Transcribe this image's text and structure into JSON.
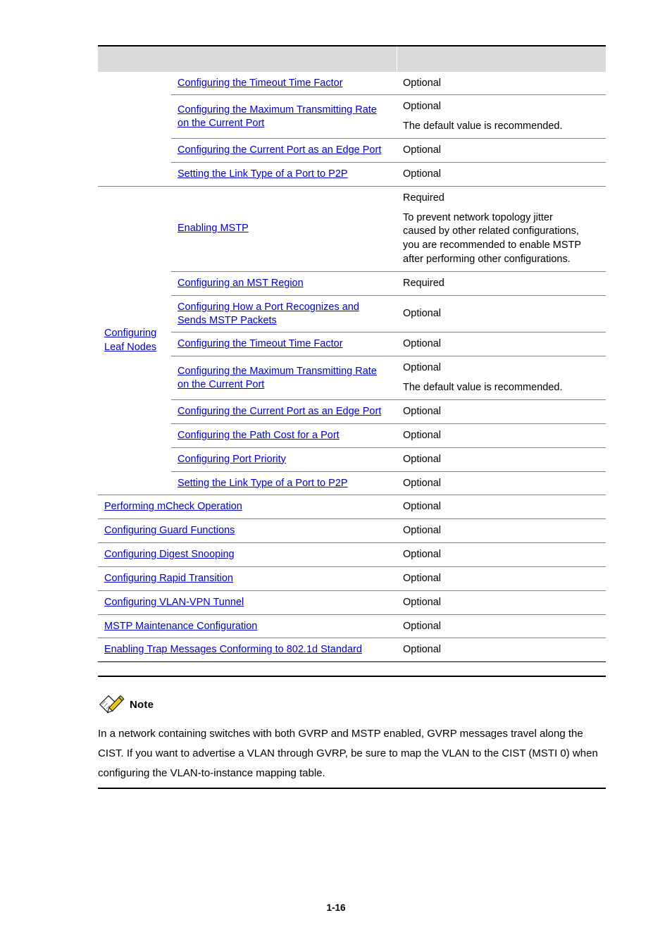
{
  "page": {
    "number": "1-16"
  },
  "table": {
    "header": {
      "col1": "",
      "col2": "",
      "col3": ""
    },
    "groups": [
      {
        "name": "",
        "rows": [
          {
            "task": "Configuring the Timeout Time Factor",
            "value": "Optional",
            "value2": ""
          },
          {
            "task": "Configuring the Maximum Transmitting Rate on the Current Port",
            "value": "Optional",
            "value2": "The default value is recommended."
          },
          {
            "task": "Configuring the Current Port as an Edge Port",
            "value": "Optional",
            "value2": ""
          },
          {
            "task": "Setting the Link Type of a Port to P2P",
            "value": "Optional",
            "value2": ""
          }
        ]
      },
      {
        "name": "Configuring Leaf Nodes",
        "name_line1": "Configuring",
        "name_line2": "Leaf Nodes",
        "rows": [
          {
            "task": "Enabling MSTP",
            "value": "Required",
            "value2_lines": [
              "To prevent network topology jitter",
              "caused by other related configurations,",
              "you are recommended to enable MSTP",
              "after performing other configurations."
            ]
          },
          {
            "task": "Configuring an MST Region",
            "value": "Required",
            "value2": ""
          },
          {
            "task": "Configuring How a Port Recognizes and Sends MSTP Packets",
            "value": "Optional",
            "value2": ""
          },
          {
            "task": "Configuring the Timeout Time Factor",
            "value": "Optional",
            "value2": ""
          },
          {
            "task": "Configuring the Maximum Transmitting Rate on the Current Port",
            "value": "Optional",
            "value2": "The default value is recommended."
          },
          {
            "task": "Configuring the Current Port as an Edge Port",
            "value": "Optional",
            "value2": ""
          },
          {
            "task": "Configuring the Path Cost for a Port",
            "value": "Optional",
            "value2": ""
          },
          {
            "task": "Configuring Port Priority",
            "value": "Optional",
            "value2": ""
          },
          {
            "task": "Setting the Link Type of a Port to P2P",
            "value": "Optional",
            "value2": ""
          }
        ]
      }
    ],
    "full_rows": [
      {
        "task": "Performing mCheck Operation",
        "value": "Optional"
      },
      {
        "task": "Configuring Guard Functions",
        "value": "Optional"
      },
      {
        "task": "Configuring Digest Snooping",
        "value": "Optional"
      },
      {
        "task": "Configuring Rapid Transition",
        "value": "Optional"
      },
      {
        "task": "Configuring VLAN-VPN Tunnel",
        "value": "Optional"
      },
      {
        "task": "MSTP Maintenance Configuration",
        "value": "Optional"
      },
      {
        "task": "Enabling Trap Messages Conforming to 802.1d Standard",
        "value": "Optional"
      }
    ]
  },
  "note": {
    "icon": "note-pencil-icon",
    "label": "Note",
    "body": "In a network containing switches with both GVRP and MSTP enabled, GVRP messages travel along the CIST. If you want to advertise a VLAN through GVRP, be sure to map the VLAN to the CIST (MSTI 0) when configuring the VLAN-to-instance mapping table."
  },
  "colors": {
    "link": "#0000CC",
    "header_bg": "#d9d9d9",
    "rule": "#000000",
    "border": "#808080"
  }
}
